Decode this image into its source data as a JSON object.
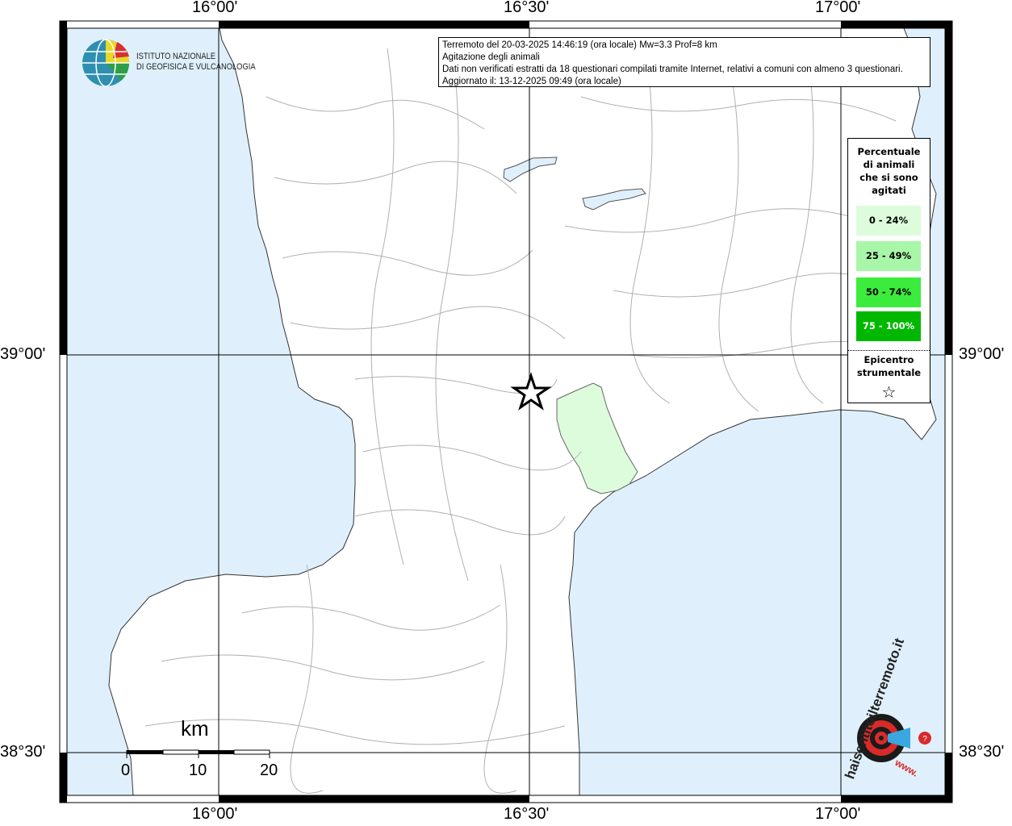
{
  "map": {
    "info": {
      "line1": "Terremoto del 20-03-2025 14:46:19 (ora locale) Mw=3.3 Prof=8 km",
      "line2": "Agitazione degli animali",
      "line3": "Dati non verificati estratti da 18 questionari compilati tramite Internet, relativi a comuni con almeno 3 questionari.",
      "line4": "Aggiornato il: 13-12-2025 09:49 (ora locale)"
    },
    "axes": {
      "top": [
        "16°00'",
        "16°30'",
        "17°00'"
      ],
      "bottom": [
        "16°00'",
        "16°30'",
        "17°00'"
      ],
      "left": [
        "39°00'",
        "38°30'"
      ],
      "right": [
        "39°00'",
        "38°30'"
      ]
    },
    "legend": {
      "title": [
        "Percentuale",
        "di animali",
        "che si sono",
        "agitati"
      ],
      "items": [
        {
          "label": "0 - 24%",
          "color": "#dcfcdc"
        },
        {
          "label": "25 - 49%",
          "color": "#a8f6a8"
        },
        {
          "label": "50 - 74%",
          "color": "#3cec3c"
        },
        {
          "label": "75 - 100%",
          "color": "#00b800"
        }
      ],
      "epicenter_title": [
        "Epicentro",
        "strumentale"
      ],
      "epicenter_symbol": "☆"
    },
    "logo": {
      "line1": "ISTITUTO NAZIONALE",
      "line2": "DI GEOFISICA E VULCANOLOGIA"
    },
    "scale": {
      "unit": "km",
      "labels": [
        "0",
        "10",
        "20"
      ]
    },
    "badge": {
      "text": "haisentitoilterremoto.it",
      "url_text": "www."
    },
    "colors": {
      "sea": "#dff0fc",
      "land": "#ffffff",
      "highlight_region": "#dcfcdc",
      "rivers": "#b0b0b0"
    }
  }
}
